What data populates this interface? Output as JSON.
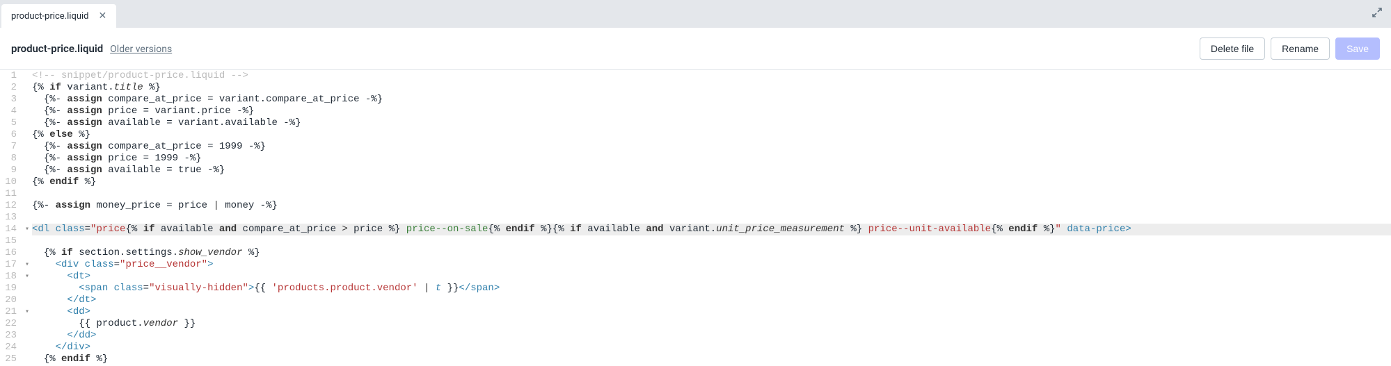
{
  "tab": {
    "label": "product-price.liquid"
  },
  "toolbar": {
    "title": "product-price.liquid",
    "older": "Older versions",
    "delete": "Delete file",
    "rename": "Rename",
    "save": "Save"
  },
  "code": {
    "l1": "<!-- snippet/product-price.liquid -->",
    "l14_class_prefix": "price",
    "l14_on_sale": " price--on-sale",
    "l14_unit": " price--unit-available",
    "l14_data_attr": " data-price",
    "l19_str": "visually-hidden",
    "l19_prod": "'products.product.vendor'",
    "l17_str": "price__vendor"
  }
}
